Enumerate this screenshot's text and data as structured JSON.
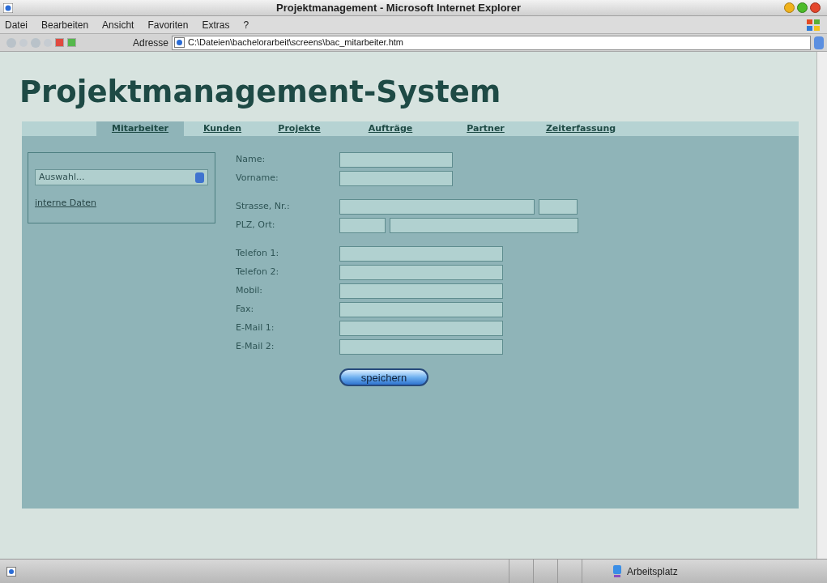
{
  "window": {
    "title": "Projektmanagement - Microsoft Internet Explorer"
  },
  "menu": [
    "Datei",
    "Bearbeiten",
    "Ansicht",
    "Favoriten",
    "Extras",
    "?"
  ],
  "address": {
    "label": "Adresse",
    "value": "C:\\Dateien\\bachelorarbeit\\screens\\bac_mitarbeiter.htm"
  },
  "page": {
    "heading": "Projektmanagement-System",
    "tabs": [
      {
        "label": "Mitarbeiter",
        "selected": true
      },
      {
        "label": "Kunden",
        "selected": false
      },
      {
        "label": "Projekte",
        "selected": false
      },
      {
        "label": "Aufträge",
        "selected": false
      },
      {
        "label": "Partner",
        "selected": false
      },
      {
        "label": "Zeiterfassung",
        "selected": false
      }
    ],
    "sidebar": {
      "select": "Auswahl...",
      "link": "interne Daten"
    },
    "form_groups": [
      [
        {
          "label": "Name:",
          "kind": "name"
        },
        {
          "label": "Vorname:",
          "kind": "name"
        }
      ],
      [
        {
          "label": "Strasse, Nr.:",
          "kind": "street"
        },
        {
          "label": "PLZ, Ort:",
          "kind": "city"
        }
      ],
      [
        {
          "label": "Telefon 1:",
          "kind": "contact"
        },
        {
          "label": "Telefon 2:",
          "kind": "contact"
        },
        {
          "label": "Mobil:",
          "kind": "contact"
        },
        {
          "label": "Fax:",
          "kind": "contact"
        },
        {
          "label": "E-Mail 1:",
          "kind": "contact"
        },
        {
          "label": "E-Mail 2:",
          "kind": "contact"
        }
      ]
    ],
    "save_button": "speichern"
  },
  "status_bar": {
    "zone": "Arbeitsplatz"
  }
}
